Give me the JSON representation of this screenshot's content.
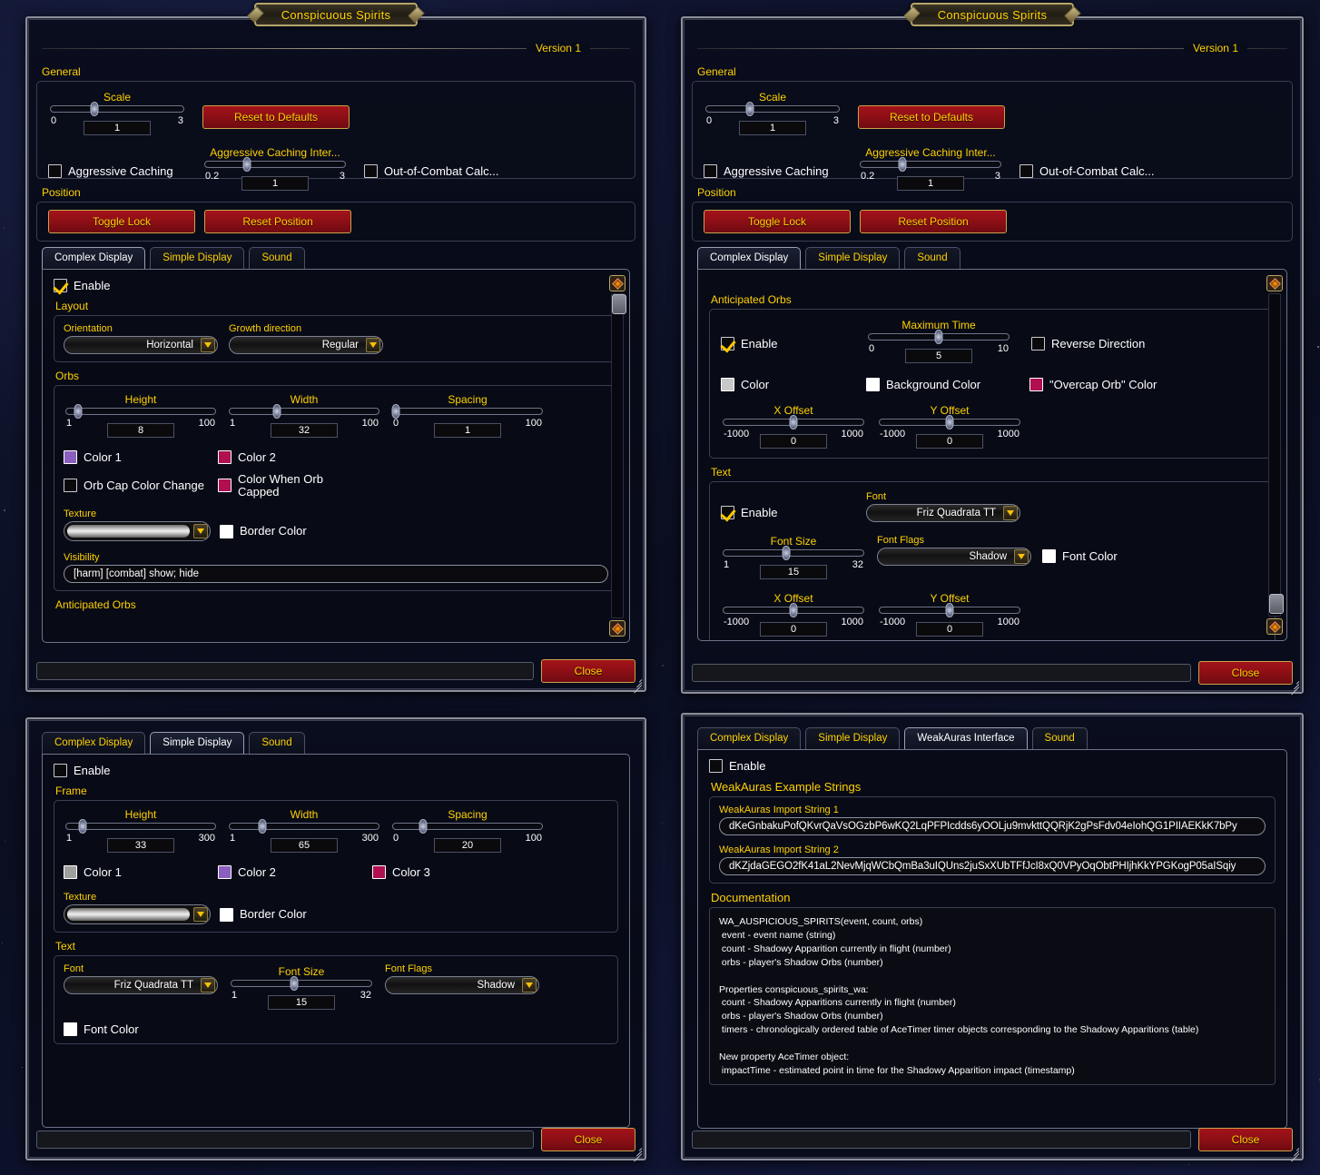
{
  "window_title": "Conspicuous Spirits",
  "version_label": "Version 1",
  "close_label": "Close",
  "general": {
    "section_label": "General",
    "scale": {
      "label": "Scale",
      "min": "0",
      "max": "3",
      "value": "1",
      "pct": 33
    },
    "reset_defaults_label": "Reset to Defaults",
    "aggressive_caching": {
      "label": "Aggressive Caching",
      "checked": false
    },
    "aggressive_caching_interval": {
      "label": "Aggressive Caching Inter...",
      "min": "0.2",
      "max": "3",
      "value": "1",
      "pct": 30
    },
    "out_of_combat": {
      "label": "Out-of-Combat Calc...",
      "checked": false
    }
  },
  "position": {
    "section_label": "Position",
    "toggle_lock_label": "Toggle Lock",
    "reset_position_label": "Reset Position"
  },
  "panel1": {
    "tabs": [
      {
        "label": "Complex Display",
        "active": true
      },
      {
        "label": "Simple Display",
        "active": false
      },
      {
        "label": "Sound",
        "active": false
      }
    ],
    "enable": {
      "label": "Enable",
      "checked": true
    },
    "layout": {
      "section_label": "Layout",
      "orientation": {
        "label": "Orientation",
        "value": "Horizontal"
      },
      "growth_direction": {
        "label": "Growth direction",
        "value": "Regular"
      }
    },
    "orbs": {
      "section_label": "Orbs",
      "height": {
        "label": "Height",
        "min": "1",
        "max": "100",
        "value": "8",
        "pct": 8
      },
      "width": {
        "label": "Width",
        "min": "1",
        "max": "100",
        "value": "32",
        "pct": 32
      },
      "spacing": {
        "label": "Spacing",
        "min": "0",
        "max": "100",
        "value": "1",
        "pct": 2
      },
      "color1": {
        "label": "Color 1",
        "color": "#8b5fbf"
      },
      "color2": {
        "label": "Color 2",
        "color": "#b01050"
      },
      "orb_cap_color_change": {
        "label": "Orb Cap Color Change",
        "checked": false
      },
      "color_when_capped": {
        "label": "Color When Orb Capped",
        "color": "#b01050"
      },
      "texture": {
        "label": "Texture"
      },
      "border_color": {
        "label": "Border Color",
        "color": "#ffffff"
      },
      "visibility": {
        "label": "Visibility",
        "value": "[harm] [combat] show; hide"
      }
    },
    "anticipated_orbs_label": "Anticipated Orbs"
  },
  "panel2": {
    "tabs": [
      {
        "label": "Complex Display",
        "active": true
      },
      {
        "label": "Simple Display",
        "active": false
      },
      {
        "label": "Sound",
        "active": false
      }
    ],
    "anticipated_orbs": {
      "section_label": "Anticipated Orbs",
      "enable": {
        "label": "Enable",
        "checked": true
      },
      "maximum_time": {
        "label": "Maximum Time",
        "min": "0",
        "max": "10",
        "value": "5",
        "pct": 50
      },
      "reverse_direction": {
        "label": "Reverse Direction",
        "checked": false
      },
      "color": {
        "label": "Color",
        "color": "#c8c8c8"
      },
      "background_color": {
        "label": "Background Color",
        "color": "#ffffff"
      },
      "overcap_color": {
        "label": "\"Overcap Orb\" Color",
        "color": "#b01050"
      },
      "x_offset": {
        "label": "X Offset",
        "min": "-1000",
        "max": "1000",
        "value": "0",
        "pct": 50
      },
      "y_offset": {
        "label": "Y Offset",
        "min": "-1000",
        "max": "1000",
        "value": "0",
        "pct": 50
      }
    },
    "text": {
      "section_label": "Text",
      "enable": {
        "label": "Enable",
        "checked": true
      },
      "font": {
        "label": "Font",
        "value": "Friz Quadrata TT"
      },
      "font_size": {
        "label": "Font Size",
        "min": "1",
        "max": "32",
        "value": "15",
        "pct": 45
      },
      "font_flags": {
        "label": "Font Flags",
        "value": "Shadow"
      },
      "font_color": {
        "label": "Font Color",
        "color": "#ffffff"
      },
      "x_offset": {
        "label": "X Offset",
        "min": "-1000",
        "max": "1000",
        "value": "0",
        "pct": 50
      },
      "y_offset": {
        "label": "Y Offset",
        "min": "-1000",
        "max": "1000",
        "value": "0",
        "pct": 50
      }
    }
  },
  "panel3": {
    "tabs": [
      {
        "label": "Complex Display",
        "active": false
      },
      {
        "label": "Simple Display",
        "active": true
      },
      {
        "label": "Sound",
        "active": false
      }
    ],
    "enable": {
      "label": "Enable",
      "checked": false
    },
    "frame": {
      "section_label": "Frame",
      "height": {
        "label": "Height",
        "min": "1",
        "max": "300",
        "value": "33",
        "pct": 11
      },
      "width": {
        "label": "Width",
        "min": "1",
        "max": "300",
        "value": "65",
        "pct": 22
      },
      "spacing": {
        "label": "Spacing",
        "min": "0",
        "max": "100",
        "value": "20",
        "pct": 20
      },
      "color1": {
        "label": "Color 1",
        "color": "#a0a0a0"
      },
      "color2": {
        "label": "Color 2",
        "color": "#8b5fbf"
      },
      "color3": {
        "label": "Color 3",
        "color": "#b01050"
      },
      "texture": {
        "label": "Texture"
      },
      "border_color": {
        "label": "Border Color",
        "color": "#ffffff"
      }
    },
    "text": {
      "section_label": "Text",
      "font": {
        "label": "Font",
        "value": "Friz Quadrata TT"
      },
      "font_size": {
        "label": "Font Size",
        "min": "1",
        "max": "32",
        "value": "15",
        "pct": 45
      },
      "font_flags": {
        "label": "Font Flags",
        "value": "Shadow"
      },
      "font_color": {
        "label": "Font Color",
        "color": "#ffffff"
      }
    }
  },
  "panel4": {
    "tabs": [
      {
        "label": "Complex Display",
        "active": false
      },
      {
        "label": "Simple Display",
        "active": false
      },
      {
        "label": "WeakAuras Interface",
        "active": true
      },
      {
        "label": "Sound",
        "active": false
      }
    ],
    "enable": {
      "label": "Enable",
      "checked": false
    },
    "weakauras": {
      "section_label": "WeakAuras Example Strings",
      "string1_label": "WeakAuras Import String 1",
      "string1_value": "dKeGnbakuPofQKvrQaVsOGzbP6wKQ2LqPFPIcdds6yOOLju9mvkttQQRjK2gPsFdv04eIohQG1PIIAEKkK7bPy",
      "string2_label": "WeakAuras Import String 2",
      "string2_value": "dKZjdaGEGO2fK41aL2NevMjqWCbQmBa3uIQUns2juSxXUbTFfJcI8xQ0VPyOqObtPHIjhKkYPGKogP05aISqiy"
    },
    "documentation": {
      "section_label": "Documentation",
      "text": "WA_AUSPICIOUS_SPIRITS(event, count, orbs)\n event - event name (string)\n count - Shadowy Apparition currently in flight (number)\n orbs - player's Shadow Orbs (number)\n\nProperties conspicuous_spirits_wa:\n count - Shadowy Apparitions currently in flight (number)\n orbs - player's Shadow Orbs (number)\n timers - chronologically ordered table of AceTimer timer objects corresponding to the Shadowy Apparitions (table)\n\nNew property AceTimer object:\n impactTime - estimated point in time for the Shadowy Apparition impact (timestamp)"
    }
  }
}
